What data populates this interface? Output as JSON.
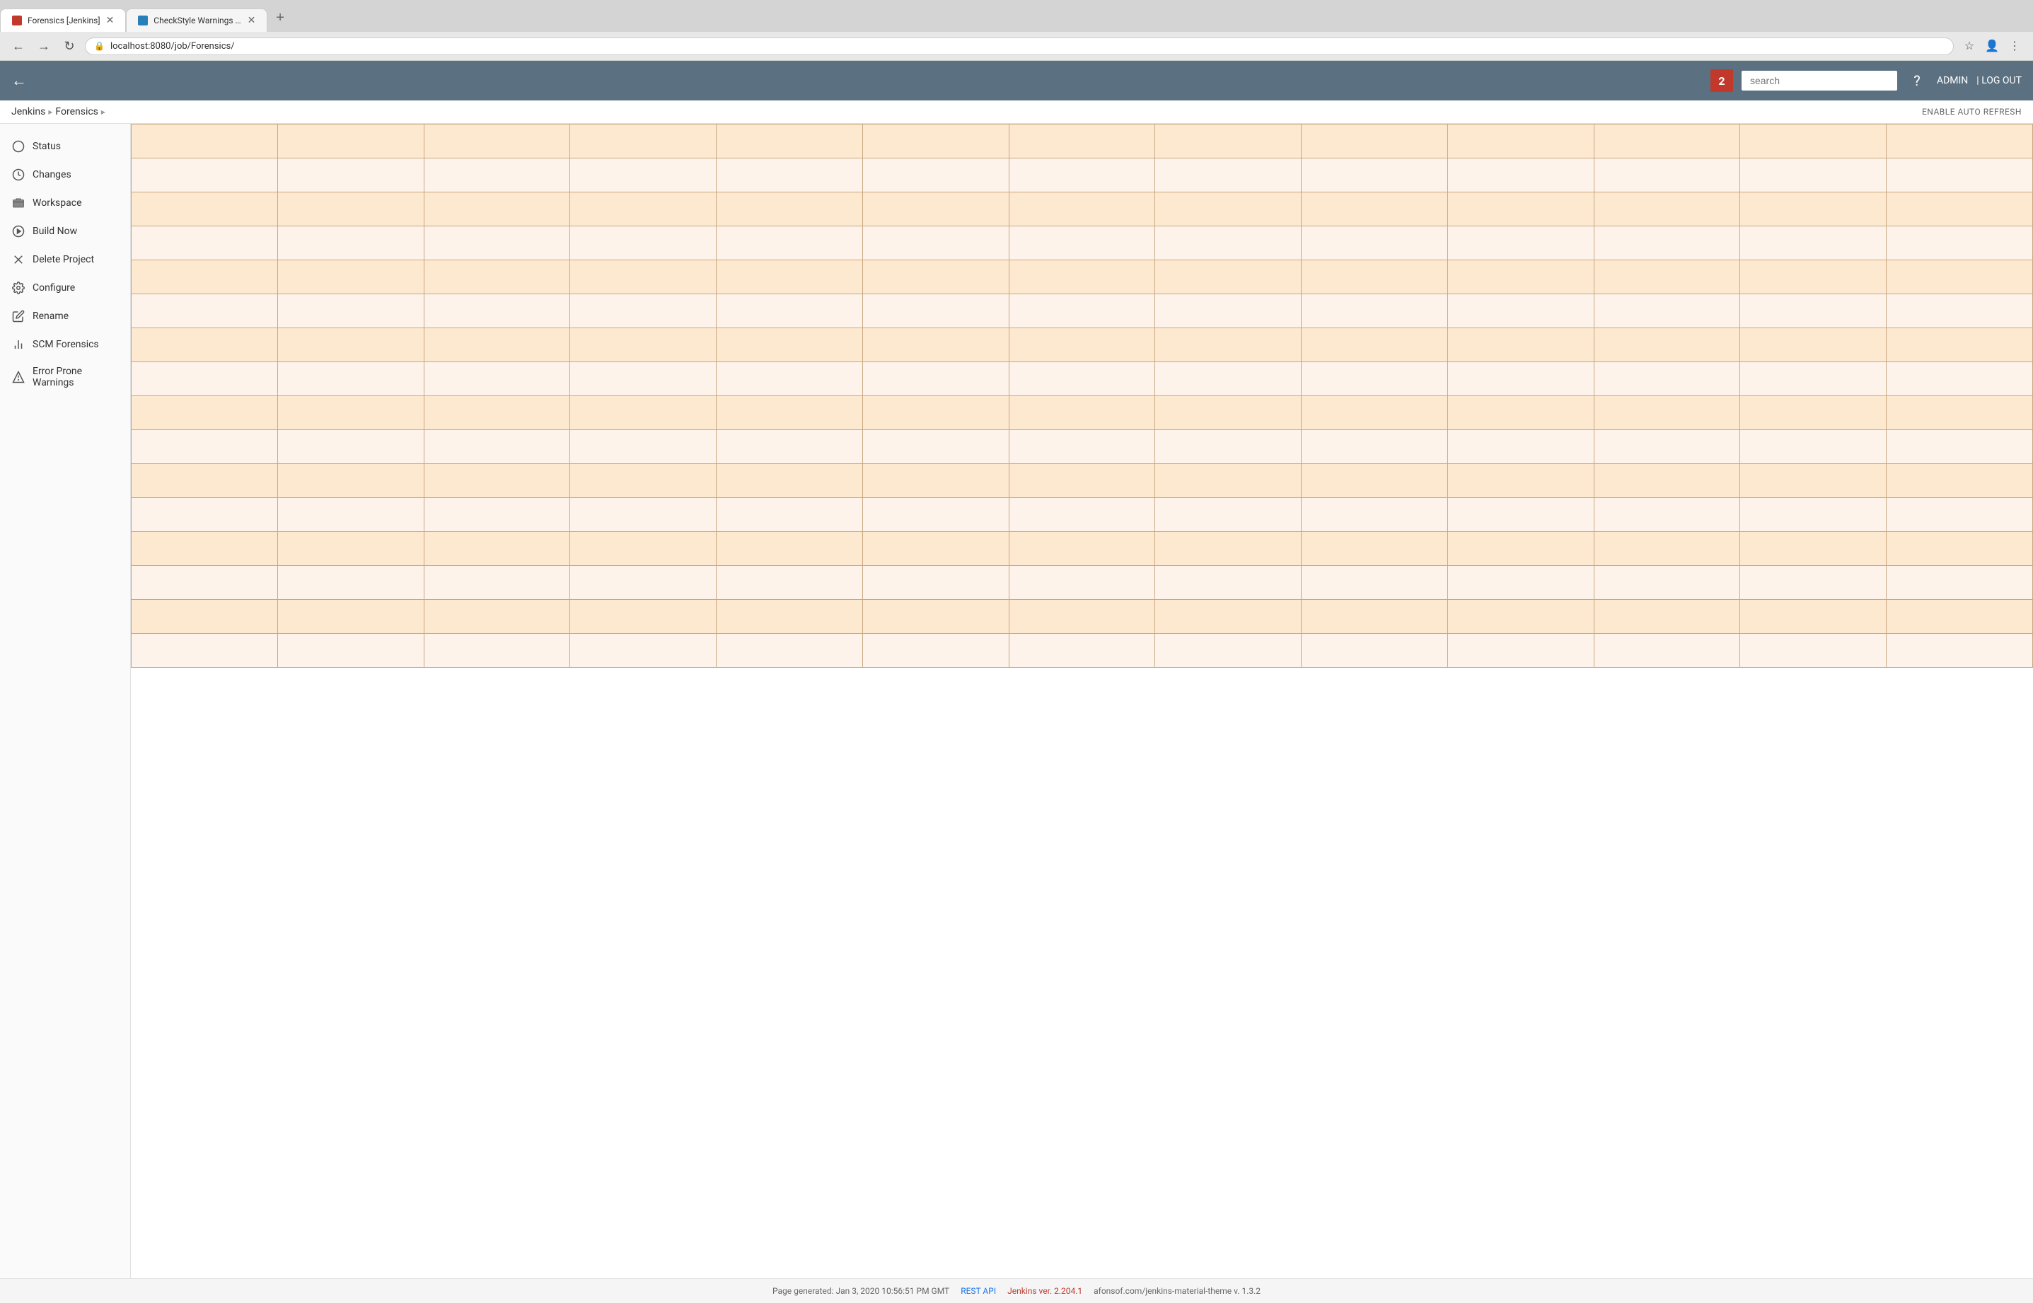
{
  "browser": {
    "tabs": [
      {
        "id": "tab1",
        "title": "Forensics [Jenkins]",
        "active": true,
        "favicon": "forensics"
      },
      {
        "id": "tab2",
        "title": "CheckStyle Warnings [Jenkins]",
        "active": false,
        "favicon": "checkstyle"
      }
    ],
    "address": "localhost:8080/job/Forensics/",
    "new_tab_label": "+"
  },
  "header": {
    "back_icon": "←",
    "notification_count": "2",
    "search_placeholder": "search",
    "help_icon": "?",
    "admin_label": "ADMIN",
    "logout_label": "| LOG OUT"
  },
  "breadcrumb": {
    "items": [
      {
        "label": "Jenkins"
      },
      {
        "label": "Forensics"
      }
    ],
    "action_label": "ENABLE AUTO REFRESH"
  },
  "sidebar": {
    "items": [
      {
        "id": "status",
        "label": "Status",
        "icon": "circle"
      },
      {
        "id": "changes",
        "label": "Changes",
        "icon": "clock"
      },
      {
        "id": "workspace",
        "label": "Workspace",
        "icon": "folder"
      },
      {
        "id": "build-now",
        "label": "Build Now",
        "icon": "play"
      },
      {
        "id": "delete-project",
        "label": "Delete Project",
        "icon": "delete"
      },
      {
        "id": "configure",
        "label": "Configure",
        "icon": "gear"
      },
      {
        "id": "rename",
        "label": "Rename",
        "icon": "rename"
      },
      {
        "id": "scm-forensics",
        "label": "SCM Forensics",
        "icon": "chart"
      },
      {
        "id": "error-prone",
        "label": "Error Prone Warnings",
        "icon": "warning"
      }
    ]
  },
  "grid": {
    "rows": 16,
    "cols": 13
  },
  "footer": {
    "generated_text": "Page generated: Jan 3, 2020 10:56:51 PM GMT",
    "rest_api_label": "REST API",
    "jenkins_version_label": "Jenkins ver. 2.204.1",
    "theme_label": "afonsof.com/jenkins-material-theme v. 1.3.2"
  }
}
